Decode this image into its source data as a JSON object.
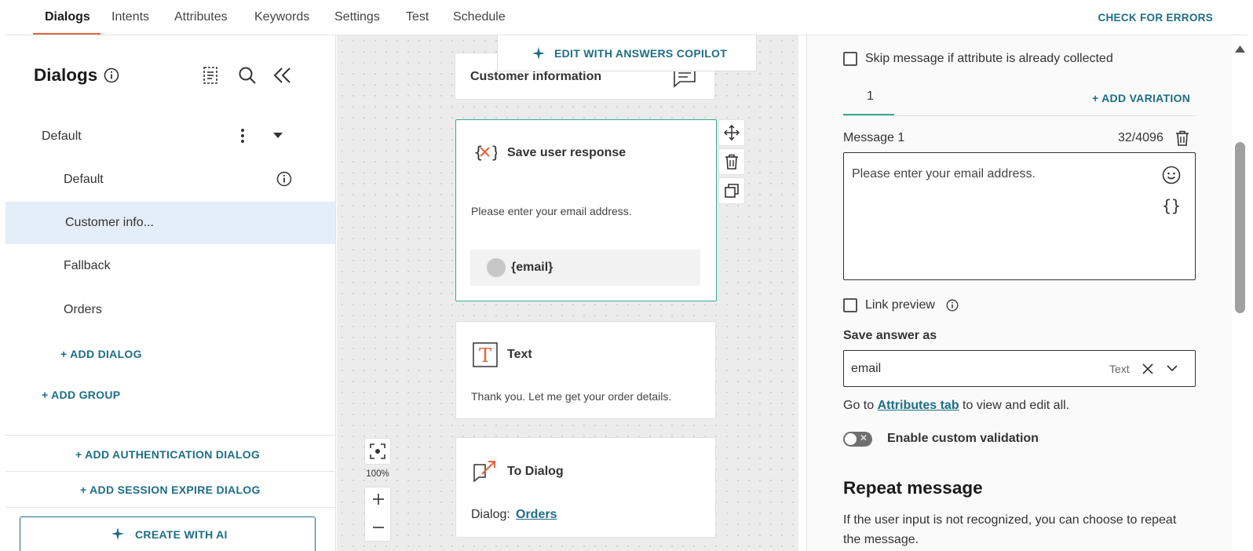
{
  "tabs": [
    {
      "label": "Dialogs",
      "active": true
    },
    {
      "label": "Intents"
    },
    {
      "label": "Attributes"
    },
    {
      "label": "Keywords"
    },
    {
      "label": "Settings"
    },
    {
      "label": "Test"
    },
    {
      "label": "Schedule"
    }
  ],
  "check_errors_label": "CHECK FOR ERRORS",
  "sidebar": {
    "title": "Dialogs",
    "group_name": "Default",
    "items": [
      {
        "label": "Default"
      },
      {
        "label": "Customer info..."
      },
      {
        "label": "Fallback"
      },
      {
        "label": "Orders"
      }
    ],
    "add_dialog": "+ ADD DIALOG",
    "add_group": "+ ADD GROUP",
    "add_auth_dialog": "+ ADD AUTHENTICATION DIALOG",
    "add_session_expire_dialog": "+ ADD SESSION EXPIRE DIALOG",
    "create_with_ai": "CREATE WITH AI"
  },
  "canvas": {
    "copilot_label": "EDIT WITH ANSWERS COPILOT",
    "zoom_level": "100%",
    "nodes": {
      "customer_info": {
        "title": "Customer information"
      },
      "save_user_response": {
        "title": "Save user response",
        "text": "Please enter your email address.",
        "attribute": "{email}"
      },
      "text": {
        "title": "Text",
        "text": "Thank you. Let me get your order details."
      },
      "to_dialog": {
        "title": "To Dialog",
        "dialog_label": "Dialog:",
        "dialog_link": "Orders"
      }
    }
  },
  "panel": {
    "skip_message_label": "Skip message if attribute is already collected",
    "variation_tab": "1",
    "add_variation": "+ ADD VARIATION",
    "message_label": "Message 1",
    "char_count": "32/4096",
    "message_value": "Please enter your email address.",
    "link_preview_label": "Link preview",
    "save_answer_label": "Save answer as",
    "save_answer_value": "email",
    "save_answer_type": "Text",
    "goto_prefix": "Go to",
    "attributes_link": "Attributes tab",
    "goto_suffix": "to view and edit all.",
    "custom_validation_label": "Enable custom validation",
    "custom_validation_enabled": false,
    "repeat_title": "Repeat message",
    "repeat_desc": "If the user input is not recognized, you can choose to repeat the message."
  },
  "colors": {
    "accent_teal": "#1d6e86",
    "accent_orange": "#e8623a",
    "selected_node_border": "#3aaa8f",
    "selected_item_bg": "#e4eef8"
  }
}
